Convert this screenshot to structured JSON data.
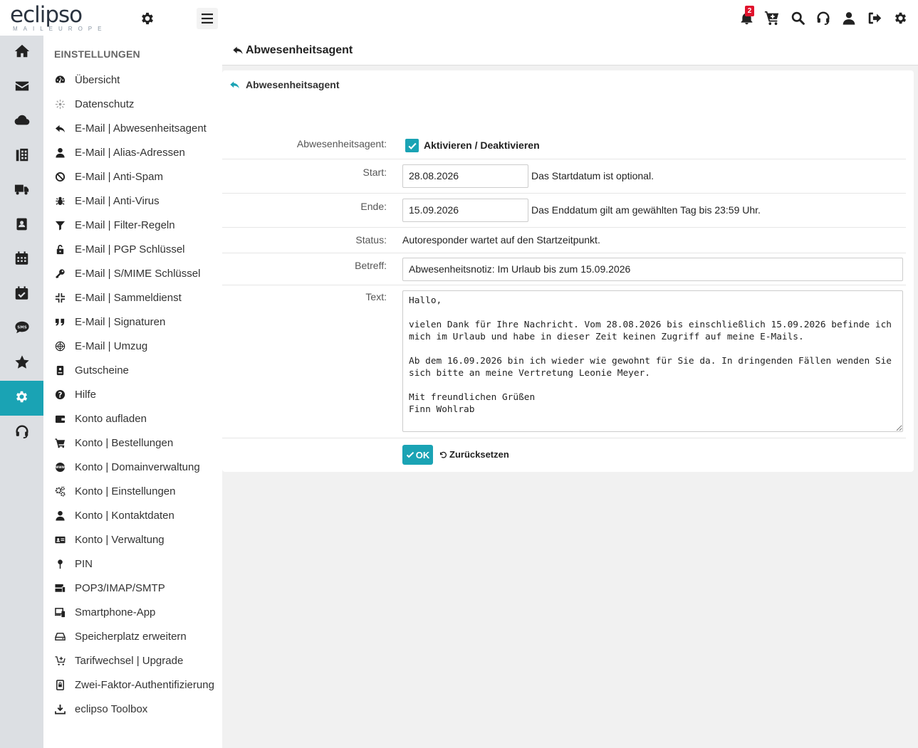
{
  "app": {
    "logo_text": "eclipso",
    "logo_subtext": "MAILEUROPE",
    "notification_count": "2",
    "accent_color": "#1aa3b4"
  },
  "top_icons": [
    "bell-icon",
    "cart-icon",
    "search-icon",
    "headset-icon",
    "user-icon",
    "logout-icon",
    "gear-icon"
  ],
  "rail": {
    "items": [
      "home-icon",
      "mail-icon",
      "cloud-icon",
      "office-icon",
      "delivery-truck-icon",
      "address-book-icon",
      "calendar-icon",
      "tasks-icon",
      "sms-icon",
      "star-icon",
      "gear-icon",
      "support-icon"
    ],
    "active_index": 10
  },
  "menu": {
    "title": "EINSTELLUNGEN",
    "items": [
      {
        "label": "Übersicht",
        "icon": "dashboard-icon"
      },
      {
        "label": "Datenschutz",
        "icon": "privacy-icon"
      },
      {
        "label": "E-Mail | Abwesenheitsagent",
        "icon": "reply-icon"
      },
      {
        "label": "E-Mail | Alias-Adressen",
        "icon": "user-icon"
      },
      {
        "label": "E-Mail | Anti-Spam",
        "icon": "ban-icon"
      },
      {
        "label": "E-Mail | Anti-Virus",
        "icon": "bug-icon"
      },
      {
        "label": "E-Mail | Filter-Regeln",
        "icon": "filter-icon"
      },
      {
        "label": "E-Mail | PGP Schlüssel",
        "icon": "unlock-icon"
      },
      {
        "label": "E-Mail | S/MIME Schlüssel",
        "icon": "key-icon"
      },
      {
        "label": "E-Mail | Sammeldienst",
        "icon": "compress-icon"
      },
      {
        "label": "E-Mail | Signaturen",
        "icon": "quote-icon"
      },
      {
        "label": "E-Mail | Umzug",
        "icon": "globe-icon"
      },
      {
        "label": "Gutscheine",
        "icon": "voucher-icon"
      },
      {
        "label": "Hilfe",
        "icon": "help-icon"
      },
      {
        "label": "Konto aufladen",
        "icon": "wallet-icon"
      },
      {
        "label": "Konto | Bestellungen",
        "icon": "cart-icon"
      },
      {
        "label": "Konto | Domainverwaltung",
        "icon": "www-icon"
      },
      {
        "label": "Konto | Einstellungen",
        "icon": "gears-icon"
      },
      {
        "label": "Konto | Kontaktdaten",
        "icon": "user-icon"
      },
      {
        "label": "Konto | Verwaltung",
        "icon": "id-card-icon"
      },
      {
        "label": "PIN",
        "icon": "pin-icon"
      },
      {
        "label": "POP3/IMAP/SMTP",
        "icon": "server-icon"
      },
      {
        "label": "Smartphone-App",
        "icon": "devices-icon"
      },
      {
        "label": "Speicherplatz erweitern",
        "icon": "hdd-icon"
      },
      {
        "label": "Tarifwechsel | Upgrade",
        "icon": "cart-plus-icon"
      },
      {
        "label": "Zwei-Faktor-Authentifizierung",
        "icon": "phone-lock-icon"
      },
      {
        "label": "eclipso Toolbox",
        "icon": "download-icon"
      }
    ]
  },
  "page": {
    "title": "Abwesenheitsagent",
    "card_title": "Abwesenheitsagent"
  },
  "form": {
    "agent_label": "Abwesenheitsagent:",
    "agent_checkbox_label": "Aktivieren / Deaktivieren",
    "agent_checked": true,
    "start_label": "Start:",
    "start_value": "28.08.2026",
    "start_hint": "Das Startdatum ist optional.",
    "end_label": "Ende:",
    "end_value": "15.09.2026",
    "end_hint": "Das Enddatum gilt am gewählten Tag bis 23:59 Uhr.",
    "status_label": "Status:",
    "status_value": "Autoresponder wartet auf den Startzeitpunkt.",
    "subject_label": "Betreff:",
    "subject_value": "Abwesenheitsnotiz: Im Urlaub bis zum 15.09.2026",
    "text_label": "Text:",
    "text_value": "Hallo,\n\nvielen Dank für Ihre Nachricht. Vom 28.08.2026 bis einschließlich 15.09.2026 befinde ich mich im Urlaub und habe in dieser Zeit keinen Zugriff auf meine E-Mails.\n\nAb dem 16.09.2026 bin ich wieder wie gewohnt für Sie da. In dringenden Fällen wenden Sie sich bitte an meine Vertretung Leonie Meyer.\n\nMit freundlichen Grüßen\nFinn Wohlrab",
    "ok_label": "OK",
    "reset_label": "Zurücksetzen"
  }
}
